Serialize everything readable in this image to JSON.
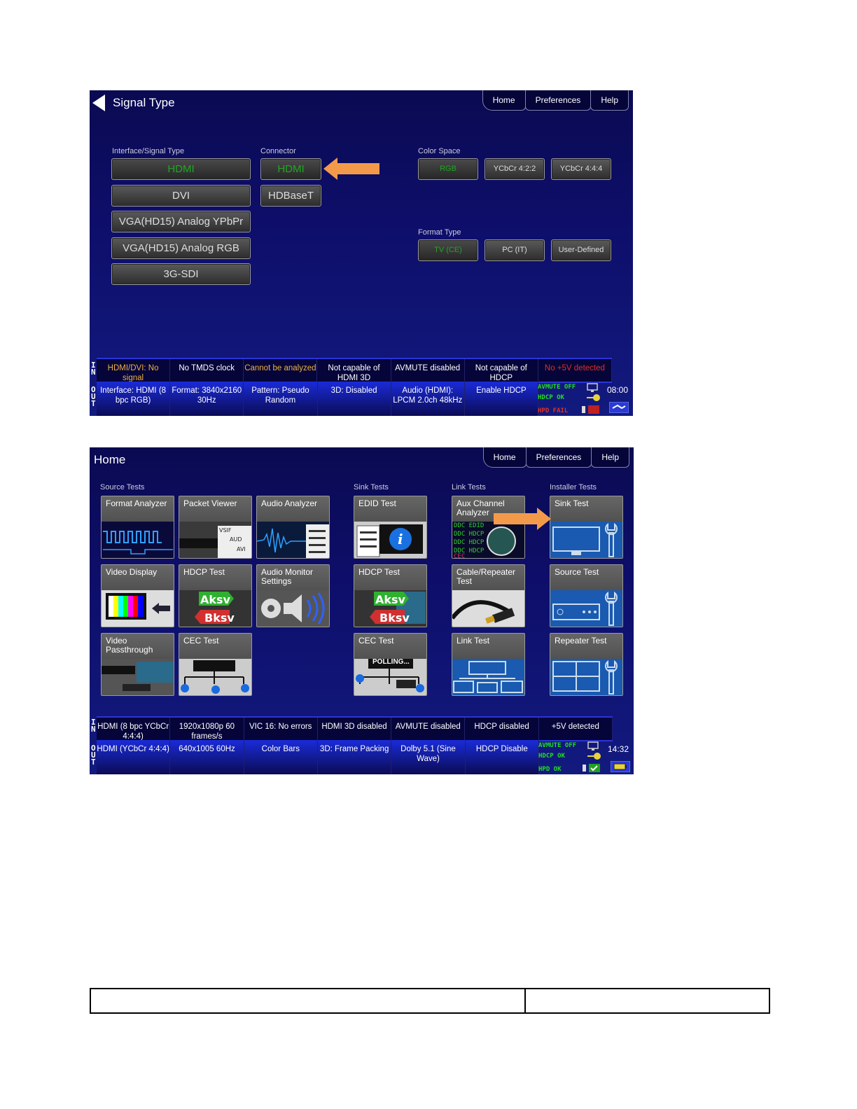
{
  "screen1": {
    "title": "Signal Type",
    "nav": [
      "Home",
      "Preferences",
      "Help"
    ],
    "interface_label": "Interface/Signal Type",
    "interface_buttons": [
      "HDMI",
      "DVI",
      "VGA(HD15) Analog YPbPr",
      "VGA(HD15) Analog RGB",
      "3G-SDI"
    ],
    "connector_label": "Connector",
    "connector_buttons": [
      "HDMI",
      "HDBaseT"
    ],
    "color_space_label": "Color Space",
    "color_space_buttons": [
      "RGB",
      "YCbCr 4:2:2",
      "YCbCr 4:4:4"
    ],
    "format_type_label": "Format Type",
    "format_type_buttons": [
      "TV (CE)",
      "PC (IT)",
      "User-Defined"
    ],
    "in_row": [
      "HDMI/DVI: No signal",
      "No TMDS clock",
      "Cannot be analyzed",
      "Not capable of HDMI 3D",
      "AVMUTE disabled",
      "Not capable of HDCP",
      "No +5V detected"
    ],
    "out_row": [
      "Interface: HDMI (8 bpc RGB)",
      "Format: 3840x2160 30Hz",
      "Pattern: Pseudo Random",
      "3D: Disabled",
      "Audio (HDMI): LPCM 2.0ch 48kHz",
      "Enable HDCP"
    ],
    "ind_avmute": "AVMUTE OFF",
    "ind_hdcp": "HDCP OK",
    "ind_hpd": "HPD FAIL",
    "clock": "08:00",
    "in_label": "IN",
    "out_label": "OUT"
  },
  "screen2": {
    "title": "Home",
    "nav": [
      "Home",
      "Preferences",
      "Help"
    ],
    "groups": [
      "Source Tests",
      "Sink Tests",
      "Link Tests",
      "Installer Tests"
    ],
    "tiles": {
      "format_analyzer": "Format Analyzer",
      "packet_viewer": "Packet Viewer",
      "audio_analyzer": "Audio Analyzer",
      "edid_test": "EDID Test",
      "aux_channel": "Aux Channel Analyzer",
      "sink_test": "Sink Test",
      "video_display": "Video Display",
      "hdcp_test_src": "HDCP Test",
      "audio_monitor": "Audio Monitor Settings",
      "hdcp_test_sink": "HDCP Test",
      "cable_repeater": "Cable/Repeater Test",
      "source_test": "Source Test",
      "video_passthrough": "Video Passthrough",
      "cec_test_src": "CEC Test",
      "cec_test_sink": "CEC Test",
      "link_test": "Link Test",
      "repeater_test": "Repeater Test"
    },
    "polling": "POLLING...",
    "in_row": [
      "HDMI (8 bpc YCbCr 4:4:4)",
      "1920x1080p 60 frames/s",
      "VIC 16: No errors",
      "HDMI 3D disabled",
      "AVMUTE disabled",
      "HDCP disabled",
      "+5V detected"
    ],
    "out_row": [
      "HDMI (YCbCr 4:4:4)",
      "640x1005 60Hz",
      "Color Bars",
      "3D: Frame Packing",
      "Dolby 5.1 (Sine Wave)",
      "HDCP Disable"
    ],
    "ind_avmute": "AVMUTE OFF",
    "ind_hdcp": "HDCP OK",
    "ind_hpd": "HPD OK",
    "clock": "14:32",
    "in_label": "IN",
    "out_label": "OUT"
  },
  "colors": {
    "selected_green": "#1ea81e",
    "arrow_orange": "#f39a4a",
    "status_orange": "#f0b040",
    "status_red": "#e03020",
    "indicator_green": "#20e020"
  }
}
